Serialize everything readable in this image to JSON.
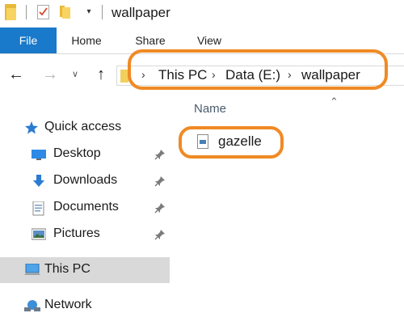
{
  "window": {
    "title": "wallpaper"
  },
  "ribbon": {
    "tabs": [
      {
        "label": "File"
      },
      {
        "label": "Home"
      },
      {
        "label": "Share"
      },
      {
        "label": "View"
      }
    ]
  },
  "address": {
    "breadcrumbs": [
      {
        "label": "This PC"
      },
      {
        "label": "Data (E:)"
      },
      {
        "label": "wallpaper"
      }
    ]
  },
  "navpane": {
    "items": [
      {
        "label": "Quick access",
        "icon": "star-icon"
      },
      {
        "label": "Desktop",
        "icon": "desktop-icon",
        "pinned": true
      },
      {
        "label": "Downloads",
        "icon": "download-arrow-icon",
        "pinned": true
      },
      {
        "label": "Documents",
        "icon": "document-icon",
        "pinned": true
      },
      {
        "label": "Pictures",
        "icon": "pictures-icon",
        "pinned": true
      },
      {
        "label": "This PC",
        "icon": "computer-icon"
      },
      {
        "label": "Network",
        "icon": "network-icon"
      }
    ]
  },
  "filelist": {
    "column_name": "Name",
    "files": [
      {
        "name": "gazelle",
        "icon": "image-file-icon"
      }
    ]
  },
  "colors": {
    "file_tab": "#1979ca",
    "annotation": "#f08a24",
    "selection": "#d9d9d9"
  }
}
